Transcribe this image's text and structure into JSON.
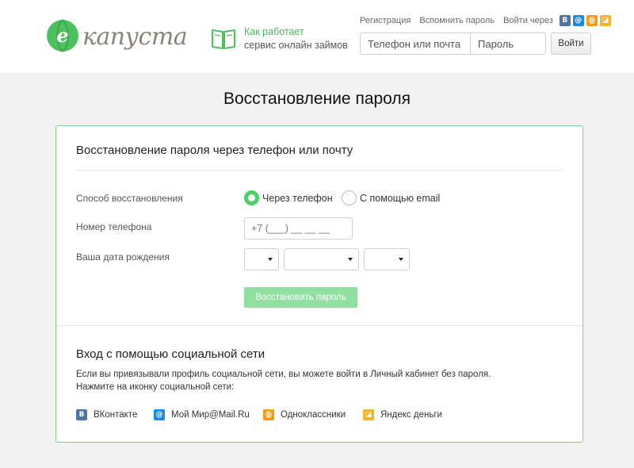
{
  "brand": {
    "logo_letter": "e",
    "logo_text": "капуста",
    "accent": "#4cd06a"
  },
  "header": {
    "how_line1": "Как работает",
    "how_line2": "сервис онлайн займов",
    "links": {
      "register": "Регистрация",
      "remind": "Вспомнить пароль",
      "login_via": "Войти через"
    },
    "social_icons": [
      "vk-icon",
      "mail-icon",
      "ok-icon",
      "yandex-money-icon"
    ],
    "phone_placeholder": "Телефон или почта",
    "password_placeholder": "Пароль",
    "login_button": "Войти"
  },
  "page": {
    "title": "Восстановление пароля"
  },
  "recovery": {
    "title": "Восстановление пароля через телефон или почту",
    "method_label": "Способ восстановления",
    "method_options": [
      {
        "label": "Через телефон",
        "selected": true
      },
      {
        "label": "С помощью email",
        "selected": false
      }
    ],
    "phone_label": "Номер телефона",
    "phone_placeholder": "+7 (___) __ __ __",
    "birth_label": "Ваша дата рождения",
    "birth_day": "",
    "birth_month": "",
    "birth_year": "",
    "submit_button": "Восстановить пароль"
  },
  "social": {
    "title": "Вход с помощью социальной сети",
    "desc_line1": "Если вы привязывали профиль социальной сети, вы можете войти в Личный кабинет без пароля.",
    "desc_line2": "Нажмите на иконку социальной сети:",
    "networks": [
      {
        "label": "ВКонтакте",
        "icon": "vk-icon",
        "color": "#4c75a3"
      },
      {
        "label": "Мой Мир@Mail.Ru",
        "icon": "mail-icon",
        "color": "#168de2"
      },
      {
        "label": "Одноклассники",
        "icon": "ok-icon",
        "color": "#f59a14"
      },
      {
        "label": "Яндекс деньги",
        "icon": "yandex-money-icon",
        "color": "#f5b22a"
      }
    ]
  }
}
